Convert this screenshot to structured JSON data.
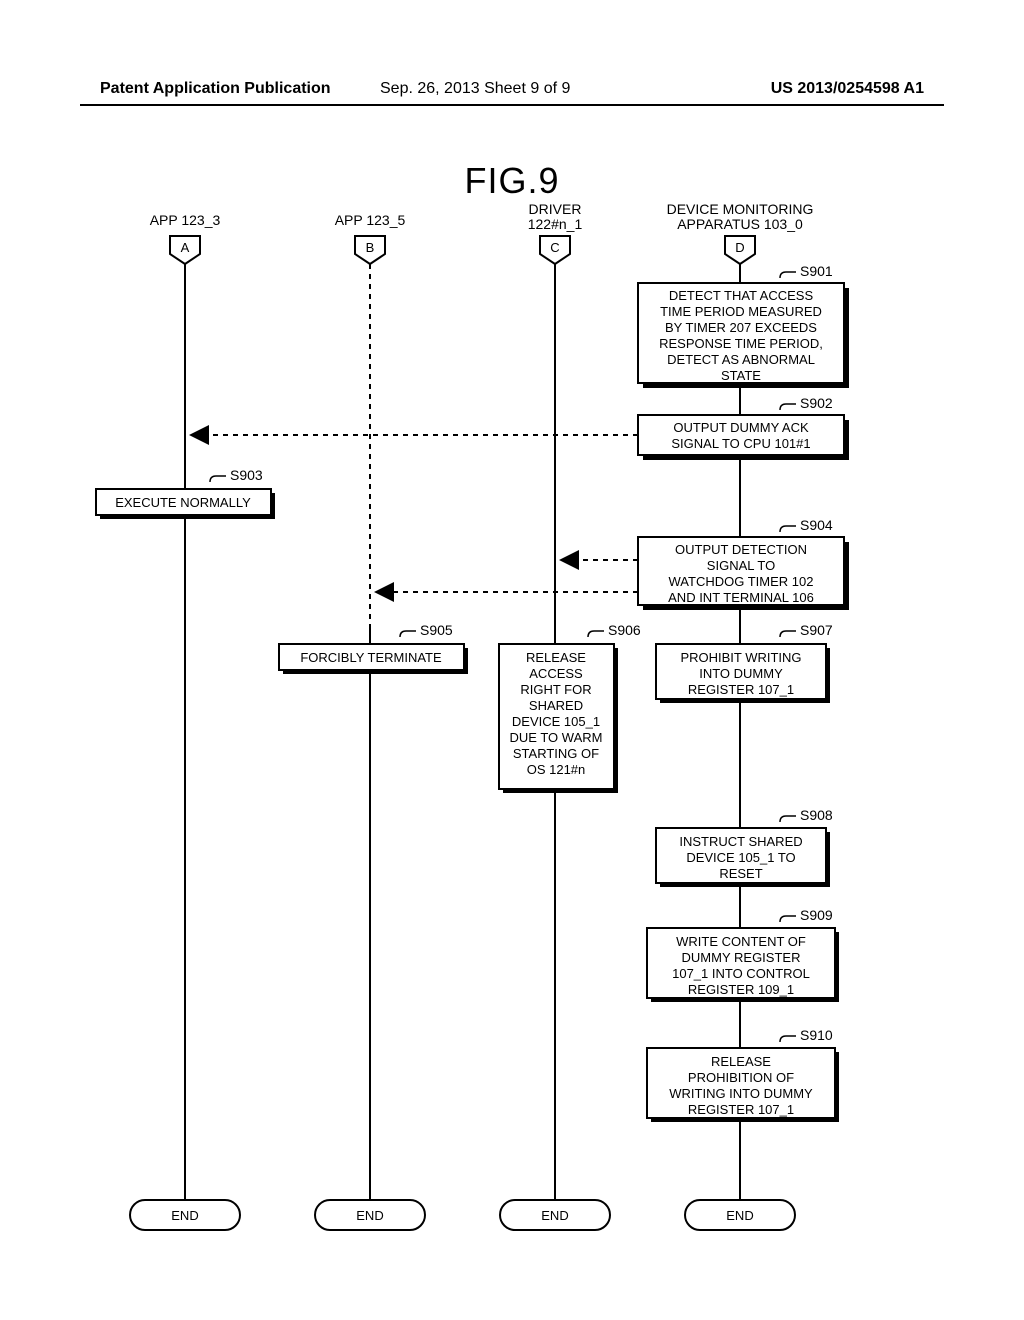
{
  "header": {
    "left": "Patent Application Publication",
    "center": "Sep. 26, 2013  Sheet 9 of 9",
    "right": "US 2013/0254598 A1"
  },
  "figure_title": "FIG.9",
  "lanes": {
    "a": {
      "title": "APP 123_3",
      "tag": "A",
      "end": "END"
    },
    "b": {
      "title": "APP 123_5",
      "tag": "B",
      "end": "END"
    },
    "c": {
      "title": "DRIVER\n122#n_1",
      "tag": "C",
      "end": "END"
    },
    "d": {
      "title": "DEVICE MONITORING\nAPPARATUS 103_0",
      "tag": "D",
      "end": "END"
    }
  },
  "steps": {
    "s901": {
      "id": "S901",
      "text": "DETECT THAT ACCESS TIME PERIOD MEASURED BY TIMER 207 EXCEEDS RESPONSE TIME PERIOD, DETECT AS ABNORMAL STATE"
    },
    "s902": {
      "id": "S902",
      "text": "OUTPUT DUMMY ACK SIGNAL TO CPU 101#1"
    },
    "s903": {
      "id": "S903",
      "text": "EXECUTE NORMALLY"
    },
    "s904": {
      "id": "S904",
      "text": "OUTPUT DETECTION SIGNAL TO WATCHDOG TIMER 102 AND INT TERMINAL 106"
    },
    "s905": {
      "id": "S905",
      "text": "FORCIBLY TERMINATE"
    },
    "s906": {
      "id": "S906",
      "text": "RELEASE ACCESS RIGHT FOR SHARED DEVICE 105_1 DUE TO WARM STARTING OF OS 121#n"
    },
    "s907": {
      "id": "S907",
      "text": "PROHIBIT WRITING INTO DUMMY REGISTER 107_1"
    },
    "s908": {
      "id": "S908",
      "text": "INSTRUCT SHARED DEVICE 105_1 TO RESET"
    },
    "s909": {
      "id": "S909",
      "text": "WRITE CONTENT OF DUMMY REGISTER 107_1 INTO CONTROL REGISTER 109_1"
    },
    "s910": {
      "id": "S910",
      "text": "RELEASE PROHIBITION OF WRITING INTO DUMMY REGISTER 107_1"
    }
  }
}
